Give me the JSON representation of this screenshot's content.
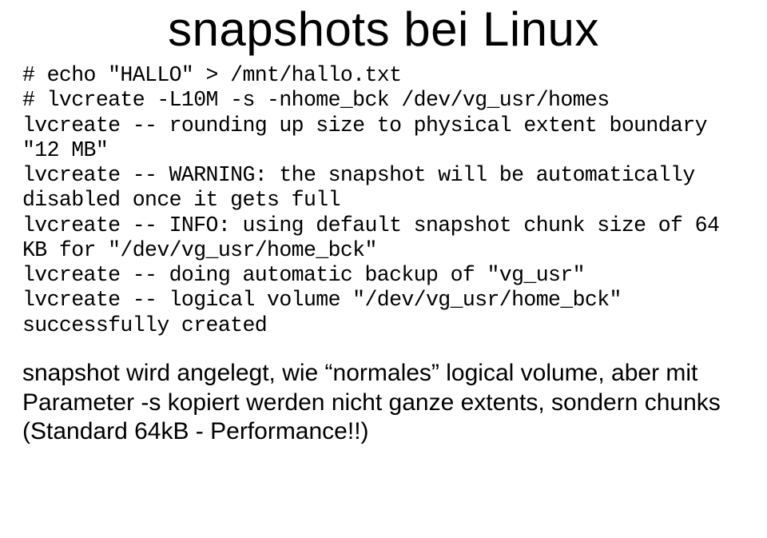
{
  "title": "snapshots bei Linux",
  "code": "# echo \"HALLO\" > /mnt/hallo.txt\n# lvcreate -L10M -s -nhome_bck /dev/vg_usr/homes\nlvcreate -- rounding up size to physical extent boundary \"12 MB\"\nlvcreate -- WARNING: the snapshot will be automatically disabled once it gets full\nlvcreate -- INFO: using default snapshot chunk size of 64 KB for \"/dev/vg_usr/home_bck\"\nlvcreate -- doing automatic backup of \"vg_usr\"\nlvcreate -- logical volume \"/dev/vg_usr/home_bck\" successfully created",
  "notes": "snapshot wird angelegt, wie “normales” logical volume, aber mit Parameter -s\nkopiert werden nicht ganze extents, sondern chunks (Standard 64kB - Performance!!)"
}
